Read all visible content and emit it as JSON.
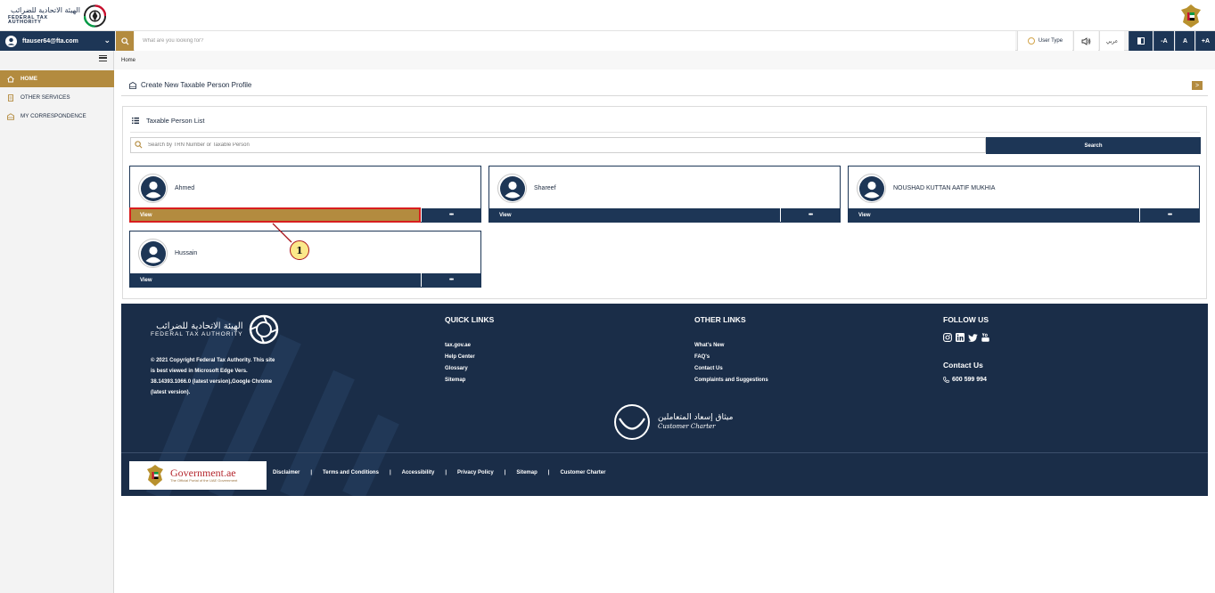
{
  "header": {
    "logo_ar": "الهيئة الاتحادية للضرائب",
    "logo_en": "FEDERAL TAX AUTHORITY"
  },
  "toolbar": {
    "user_email": "ftauser64@fta.com",
    "search_placeholder": "What are you looking for?",
    "user_type": "User Type",
    "language": "عربي",
    "font_decrease": "-A",
    "font_normal": "A",
    "font_increase": "+A"
  },
  "sidebar": {
    "items": [
      {
        "label": "HOME",
        "icon": "home-icon",
        "active": true
      },
      {
        "label": "OTHER SERVICES",
        "icon": "document-icon",
        "active": false
      },
      {
        "label": "MY CORRESPONDENCE",
        "icon": "inbox-icon",
        "active": false
      }
    ]
  },
  "breadcrumb": "Home",
  "main": {
    "create_profile_label": "Create New Taxable Person Profile",
    "create_profile_button": ">",
    "list_title": "Taxable Person List",
    "list_search_placeholder": "Search by TRN Number or Taxable Person",
    "list_search_button": "Search",
    "persons": [
      {
        "name": "Ahmed",
        "view": "View",
        "more": "•••"
      },
      {
        "name": "Shareef",
        "view": "View",
        "more": "•••"
      },
      {
        "name": "NOUSHAD KUTTAN AATIF MUKHIA",
        "view": "View",
        "more": "•••"
      },
      {
        "name": "Hussain",
        "view": "View",
        "more": "•••"
      }
    ],
    "callout_number": "1"
  },
  "footer": {
    "logo_ar": "الهيئة الاتحادية للضرائب",
    "logo_en": "FEDERAL TAX AUTHORITY",
    "copyright": "© 2021 Copyright Federal Tax Authority. This site is best viewed in Microsoft Edge Vers. 38.14393.1066.0 (latest version),Google Chrome (latest version).",
    "quick_links_title": "QUICK LINKS",
    "quick_links": [
      "tax.gov.ae",
      "Help Center",
      "Glossary",
      "Sitemap"
    ],
    "other_links_title": "OTHER LINKS",
    "other_links": [
      "What's New",
      "FAQ's",
      "Contact Us",
      "Complaints and Suggestions"
    ],
    "follow_title": "FOLLOW US",
    "social_icons": [
      "instagram-icon",
      "linkedin-icon",
      "twitter-icon",
      "youtube-icon"
    ],
    "contact_title": "Contact Us",
    "phone": "600 599 994",
    "charter_ar": "ميثاق إسعاد المتعاملين",
    "charter_en": "Customer Charter",
    "gov_logo_title": "Government.ae",
    "gov_logo_subtitle": "The Official Portal of the UAE Government",
    "bottom_links": [
      "Disclaimer",
      "Terms and Conditions",
      "Accessibility",
      "Privacy Policy",
      "Sitemap",
      "Customer Charter"
    ]
  },
  "colors": {
    "navy": "#1d3656",
    "gold": "#b38b3f",
    "footer_bg": "#1a2d48",
    "highlight_border": "#d81e1e"
  }
}
